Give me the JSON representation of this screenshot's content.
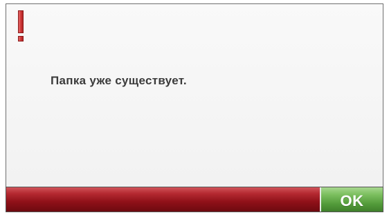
{
  "dialog": {
    "icon": "exclamation-warning-icon",
    "message": "Папка уже существует.",
    "ok_label": "OK"
  },
  "colors": {
    "warning_red": "#d23a3a",
    "bar_red": "#9b1620",
    "ok_green": "#5fa844",
    "message_text": "#3b3b3b"
  }
}
